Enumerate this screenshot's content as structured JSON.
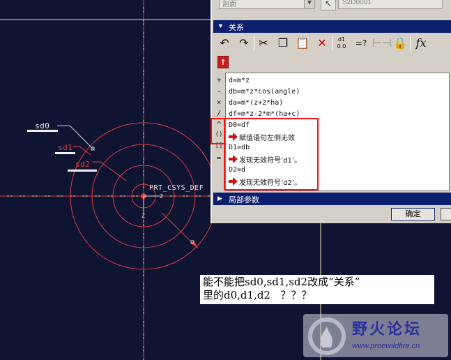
{
  "colors": {
    "canvas_background": "#0f1433",
    "geometry_red": "#e03a3a",
    "datum_yellow": "#f2e99a",
    "dialog_gray": "#d4d0c8",
    "section_bar_blue": "#0c1f6e",
    "highlight_red": "#ff1111"
  },
  "model_view": {
    "dimension_labels": [
      "sd0",
      "sd1",
      "sd2"
    ],
    "csys_label": "PRT_CSYS_DEF",
    "axis_labels": {
      "z_right": "Z",
      "z_below": "Z"
    }
  },
  "relations_dialog": {
    "top_combo_value": "剖面",
    "model_name": "S2D0001",
    "section_title": "关系",
    "toolbar": {
      "undo_icon": "undo-icon",
      "redo_icon": "redo-icon",
      "cut_icon": "scissors-icon",
      "copy_icon": "copy-icon",
      "paste_icon": "paste-icon",
      "delete_icon": "delete-x-icon",
      "switch_dims_label_top": "d1",
      "switch_dims_label_bottom": "0.0",
      "evaluate_label": "=?",
      "function_label": "fx"
    },
    "side_operators": [
      "+",
      "-",
      "×",
      "/",
      "^",
      "()",
      "[]",
      "="
    ],
    "relations": [
      "d=m*z",
      "db=m*z*cos(angle)",
      "da=m*(z+2*ha)",
      "df=m*z-2*m*(ha+c)",
      "D0=df",
      "D1=db",
      "D2=d"
    ],
    "errors": [
      "赋值语句左侧无效",
      "发现无效符号’d1’。",
      "发现无效符号’d2’。"
    ],
    "local_params_title": "局部参数",
    "ok_label": "确定"
  },
  "annotation": {
    "line1": "能不能把sd0,sd1,sd2改成“关系”",
    "line2": "里的d0,d1,d2   ？？？"
  },
  "watermark": {
    "title": "野火论坛",
    "url": "www.proewildfire.cn"
  }
}
